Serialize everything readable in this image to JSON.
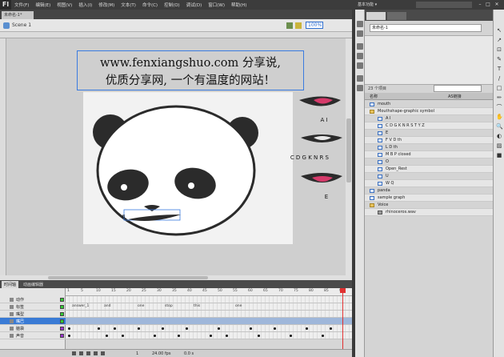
{
  "app": {
    "logo": "Fl",
    "menu": [
      "文件(F)",
      "编辑(E)",
      "视图(V)",
      "插入(I)",
      "修改(M)",
      "文本(T)",
      "命令(C)",
      "控制(O)",
      "调试(D)",
      "窗口(W)",
      "帮助(H)"
    ],
    "workspace": "基本功能 ▾",
    "win_controls": [
      "–",
      "□",
      "✕"
    ]
  },
  "document": {
    "tab_label": "未命名-1*",
    "scene_label": "Scene 1",
    "zoom": "100%"
  },
  "stage": {
    "text_line1": "www.fenxiangshuo.com 分享说,",
    "text_line2": "优质分享网, 一个有温度的网站！",
    "mouth_labels": [
      "A I",
      "C D G K N R S",
      "E"
    ],
    "lip_label": "B"
  },
  "timeline": {
    "tabs": [
      "时间轴",
      "动画编辑器"
    ],
    "layers": [
      {
        "name": "动作",
        "swatch": "#33cc33",
        "selected": false
      },
      {
        "name": "标签",
        "swatch": "#33cc33",
        "selected": false
      },
      {
        "name": "嘴型",
        "swatch": "#33cc33",
        "selected": false
      },
      {
        "name": "嘴巴",
        "swatch": "#33cc33",
        "selected": true
      },
      {
        "name": "脑袋",
        "swatch": "#9933cc",
        "selected": false
      },
      {
        "name": "声音",
        "swatch": "#9933cc",
        "selected": false
      }
    ],
    "ruler_ticks": [
      "1",
      "5",
      "10",
      "15",
      "20",
      "25",
      "30",
      "35",
      "40",
      "45",
      "50",
      "55",
      "60",
      "65",
      "70",
      "75",
      "80",
      "85",
      "90"
    ],
    "frame_labels": [
      "answer_1",
      "and",
      "one",
      "stop",
      "this",
      "one"
    ],
    "bottom": {
      "fps": "24.00 fps",
      "time": "0.0 s",
      "frame": "1"
    }
  },
  "library": {
    "tabs": [
      "属性",
      "库"
    ],
    "document_select": "未命名-1",
    "item_count": "23 个项目",
    "column_header": "名称",
    "linkage_header": "AS链接",
    "items": [
      {
        "name": "mouth",
        "type": "symbol",
        "indent": 0
      },
      {
        "name": "Mouthshape-graphic symbol",
        "type": "folder",
        "indent": 0
      },
      {
        "name": "A I",
        "type": "symbol",
        "indent": 1
      },
      {
        "name": "C D G K N R S T Y Z",
        "type": "symbol",
        "indent": 1
      },
      {
        "name": "E",
        "type": "symbol",
        "indent": 1
      },
      {
        "name": "F V D th",
        "type": "symbol",
        "indent": 1
      },
      {
        "name": "L D th",
        "type": "symbol",
        "indent": 1
      },
      {
        "name": "M B P closed",
        "type": "symbol",
        "indent": 1
      },
      {
        "name": "O",
        "type": "symbol",
        "indent": 1
      },
      {
        "name": "Open_Rest",
        "type": "symbol",
        "indent": 1
      },
      {
        "name": "U",
        "type": "symbol",
        "indent": 1
      },
      {
        "name": "W Q",
        "type": "symbol",
        "indent": 1
      },
      {
        "name": "panda",
        "type": "symbol",
        "indent": 0
      },
      {
        "name": "sample graph",
        "type": "symbol",
        "indent": 0
      },
      {
        "name": "Voice",
        "type": "folder",
        "indent": 0
      },
      {
        "name": "rhinoceros.wav",
        "type": "sound",
        "indent": 1
      }
    ]
  },
  "colors": {
    "accent": "#3a7bd5",
    "stage_bg": "#f2f2f2",
    "panda_black": "#2b2b2b",
    "mouth_pink": "#d63a6a"
  },
  "tools": [
    "↖",
    "↗",
    "⊡",
    "✎",
    "T",
    "/",
    "□",
    "✏",
    "⌒",
    "✋",
    "🔍",
    "◐",
    "▨",
    "■"
  ]
}
